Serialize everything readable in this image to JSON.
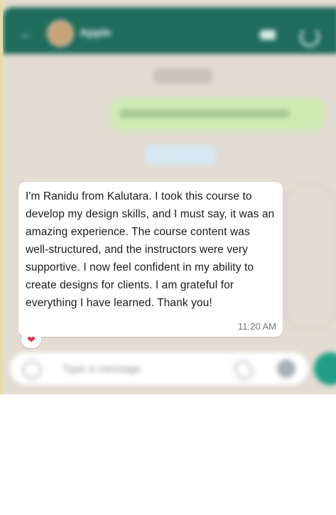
{
  "header": {
    "contact_name": "Apple"
  },
  "composer": {
    "placeholder": "Type a message"
  },
  "message": {
    "text": "I'm Ranidu from Kalutara. I took this course to develop my design skills, and I must say, it was an amazing experience. The course content was well-structured, and the instructors were very supportive. I now feel confident in my ability to create designs for clients. I am grateful for everything I have learned. Thank you!",
    "time": "11:20 AM",
    "reaction": "❤"
  },
  "colors": {
    "header_bg": "#1f6b5c",
    "chat_bg": "#e2dcd2",
    "outgoing_bubble": "#cdeab4",
    "incoming_bubble": "#ffffff",
    "send_button": "#1f9e86",
    "reaction_heart": "#e0304a"
  }
}
